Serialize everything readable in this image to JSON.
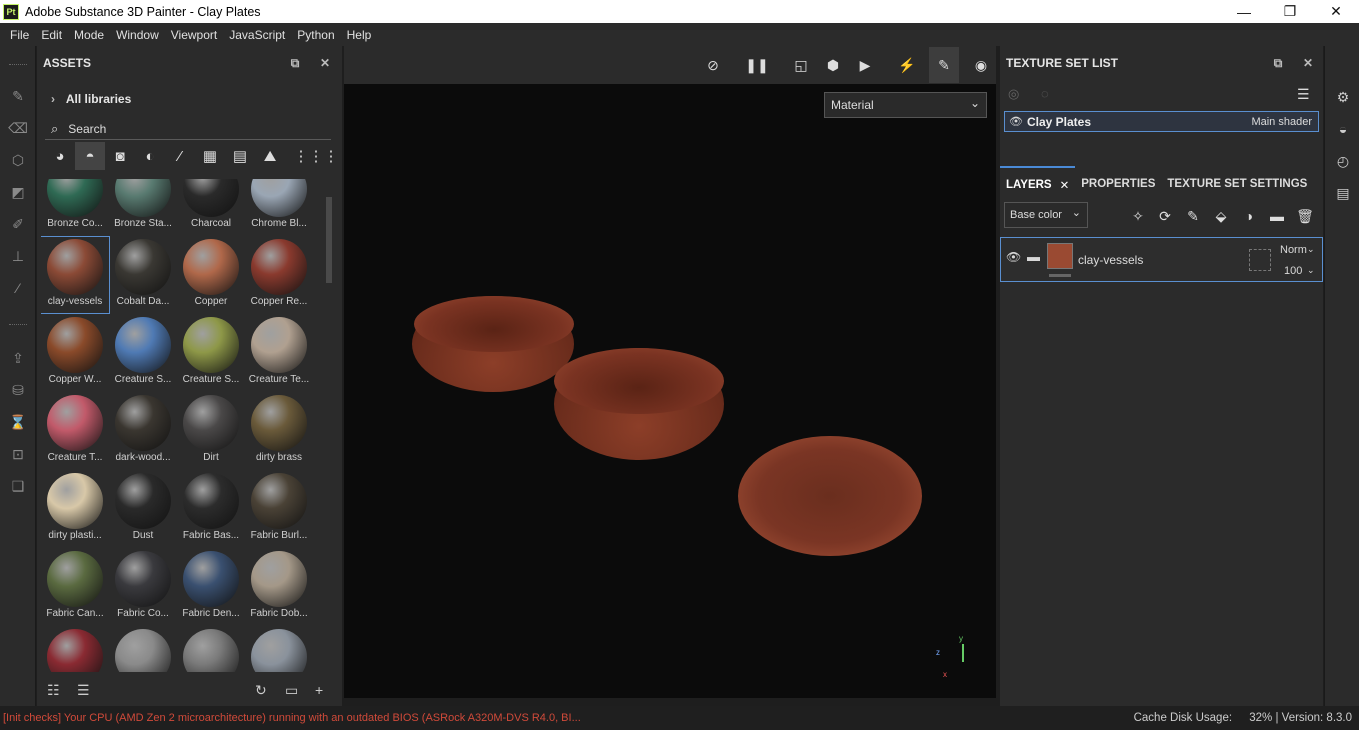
{
  "window": {
    "app_badge": "Pt",
    "title": "Adobe Substance 3D Painter - Clay Plates",
    "minimize": "—",
    "maximize": "❐",
    "close": "✕"
  },
  "menu": [
    "File",
    "Edit",
    "Mode",
    "Window",
    "Viewport",
    "JavaScript",
    "Python",
    "Help"
  ],
  "assets": {
    "title": "ASSETS",
    "library": "All libraries",
    "search_placeholder": "Search",
    "items": [
      {
        "label": "Bronze Co...",
        "color": "#2f6a54"
      },
      {
        "label": "Bronze Sta...",
        "color": "#587a70"
      },
      {
        "label": "Charcoal",
        "color": "#2a2a2a"
      },
      {
        "label": "Chrome Bl...",
        "color": "#9aa6b4"
      },
      {
        "label": "clay-vessels",
        "color": "#8b4a36"
      },
      {
        "label": "Cobalt Da...",
        "color": "#3a3833"
      },
      {
        "label": "Copper",
        "color": "#b0684a"
      },
      {
        "label": "Copper Re...",
        "color": "#8a3a2e"
      },
      {
        "label": "Copper W...",
        "color": "#8a4a2a"
      },
      {
        "label": "Creature S...",
        "color": "#4f7ab4"
      },
      {
        "label": "Creature S...",
        "color": "#8e9848"
      },
      {
        "label": "Creature Te...",
        "color": "#b0a090"
      },
      {
        "label": "Creature T...",
        "color": "#c25a6a"
      },
      {
        "label": "dark-wood...",
        "color": "#3a3630"
      },
      {
        "label": "Dirt",
        "color": "#4a4848"
      },
      {
        "label": "dirty brass",
        "color": "#6a5a3a"
      },
      {
        "label": "dirty plasti...",
        "color": "#d8c8a8"
      },
      {
        "label": "Dust",
        "color": "#2a2a2a"
      },
      {
        "label": "Fabric Bas...",
        "color": "#2c2c2c"
      },
      {
        "label": "Fabric Burl...",
        "color": "#4a4236"
      },
      {
        "label": "Fabric Can...",
        "color": "#5a6a40"
      },
      {
        "label": "Fabric Co...",
        "color": "#3a3a3e"
      },
      {
        "label": "Fabric Den...",
        "color": "#3a5070"
      },
      {
        "label": "Fabric Dob...",
        "color": "#a49888"
      },
      {
        "label": "",
        "color": "#8a2a32"
      },
      {
        "label": "",
        "color": "#8a8a8a"
      },
      {
        "label": "",
        "color": "#7a7a7a"
      },
      {
        "label": "",
        "color": "#8a929c"
      }
    ]
  },
  "viewport": {
    "mode_select": "Material"
  },
  "texture_set": {
    "title": "TEXTURE SET LIST",
    "name": "Clay Plates",
    "shader": "Main shader"
  },
  "layers": {
    "tabs": [
      "LAYERS",
      "PROPERTIES",
      "TEXTURE SET SETTINGS"
    ],
    "channel": "Base color",
    "layer": {
      "name": "clay-vessels",
      "blend": "Norm",
      "opacity": "100"
    }
  },
  "status": {
    "message": "[Init checks] Your CPU (AMD Zen 2 microarchitecture) running with an outdated BIOS (ASRock A320M-DVS R4.0, BI...",
    "cache_label": "Cache Disk Usage:",
    "cache_value": "32%",
    "version": "Version: 8.3.0"
  },
  "gizmo": {
    "x": "x",
    "y": "y",
    "z": "z"
  }
}
